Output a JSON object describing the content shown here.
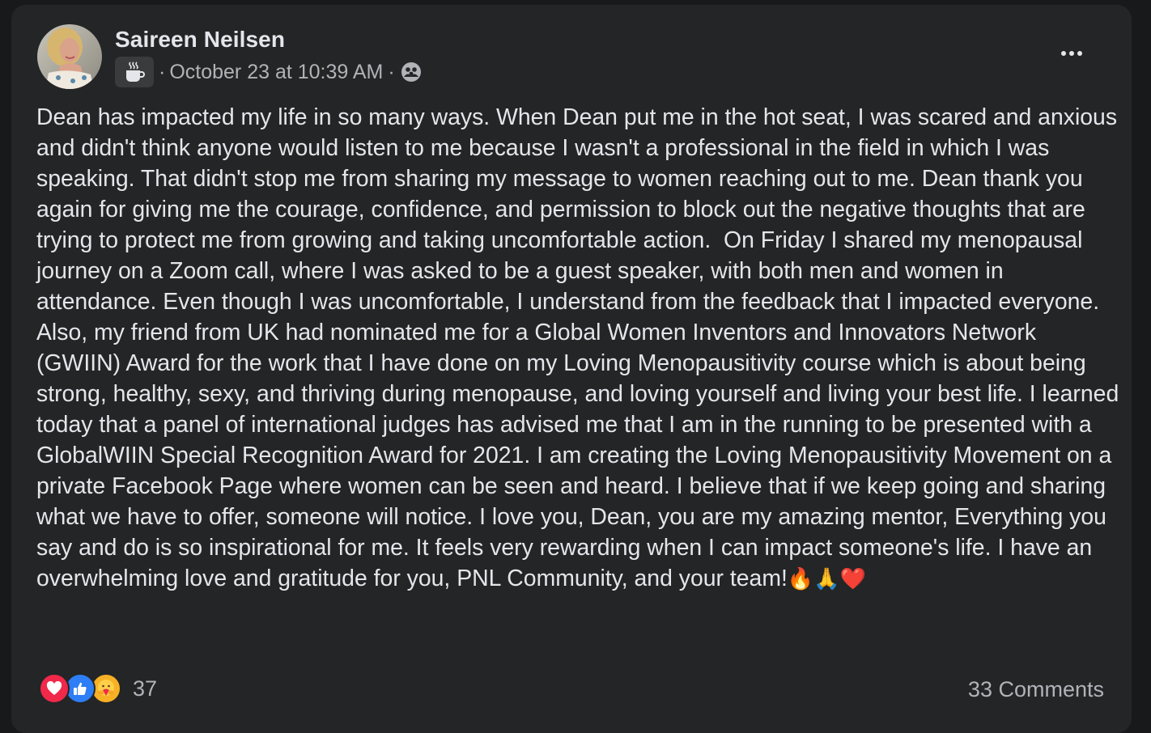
{
  "post": {
    "author": "Saireen Neilsen",
    "separator": "·",
    "timestamp": "October 23 at 10:39 AM",
    "body_text": "Dean has impacted my life in so many ways. When Dean put me in the hot seat, I was scared and anxious and didn't think anyone would listen to me because I wasn't a professional in the field in which I was speaking. That didn't stop me from sharing my message to women reaching out to me. Dean thank you again for giving me the courage, confidence, and permission to block out the negative thoughts that are trying to protect me from growing and taking uncomfortable action.  On Friday I shared my menopausal journey on a Zoom call, where I was asked to be a guest speaker, with both men and women in attendance. Even though I was uncomfortable, I understand from the feedback that I impacted everyone. Also, my friend from UK had nominated me for a Global Women Inventors and Innovators Network (GWIIN) Award for the work that I have done on my Loving Menopausitivity course which is about being strong, healthy, sexy, and thriving during menopause, and loving yourself and living your best life. I learned today that a panel of international judges has advised me that I am in the running to be presented with a GlobalWIIN Special Recognition Award for 2021. I am creating the Loving Menopausitivity Movement on a private Facebook Page where women can be seen and heard. I believe that if we keep going and sharing what we have to offer, someone will notice. I love you, Dean, you are my amazing mentor, Everything you say and do is so inspirational for me. It feels very rewarding when I can impact someone's life. I have an overwhelming love and gratitude for you, PNL Community, and your team!",
    "body_emojis": "🔥🙏❤️",
    "reaction_count": "37",
    "comments_label": "33 Comments"
  },
  "icons": {
    "group_badge": "coffee-cup-icon",
    "privacy": "group-members-icon",
    "more": "more-options-icon",
    "reactions": [
      "love-reaction-icon",
      "like-reaction-icon",
      "care-reaction-icon"
    ]
  },
  "colors": {
    "background": "#18191a",
    "card": "#242526",
    "primary_text": "#e4e6eb",
    "secondary_text": "#b0b3b8",
    "love": "#f0284a",
    "like": "#2e7ef5",
    "care": "#f7b125"
  }
}
